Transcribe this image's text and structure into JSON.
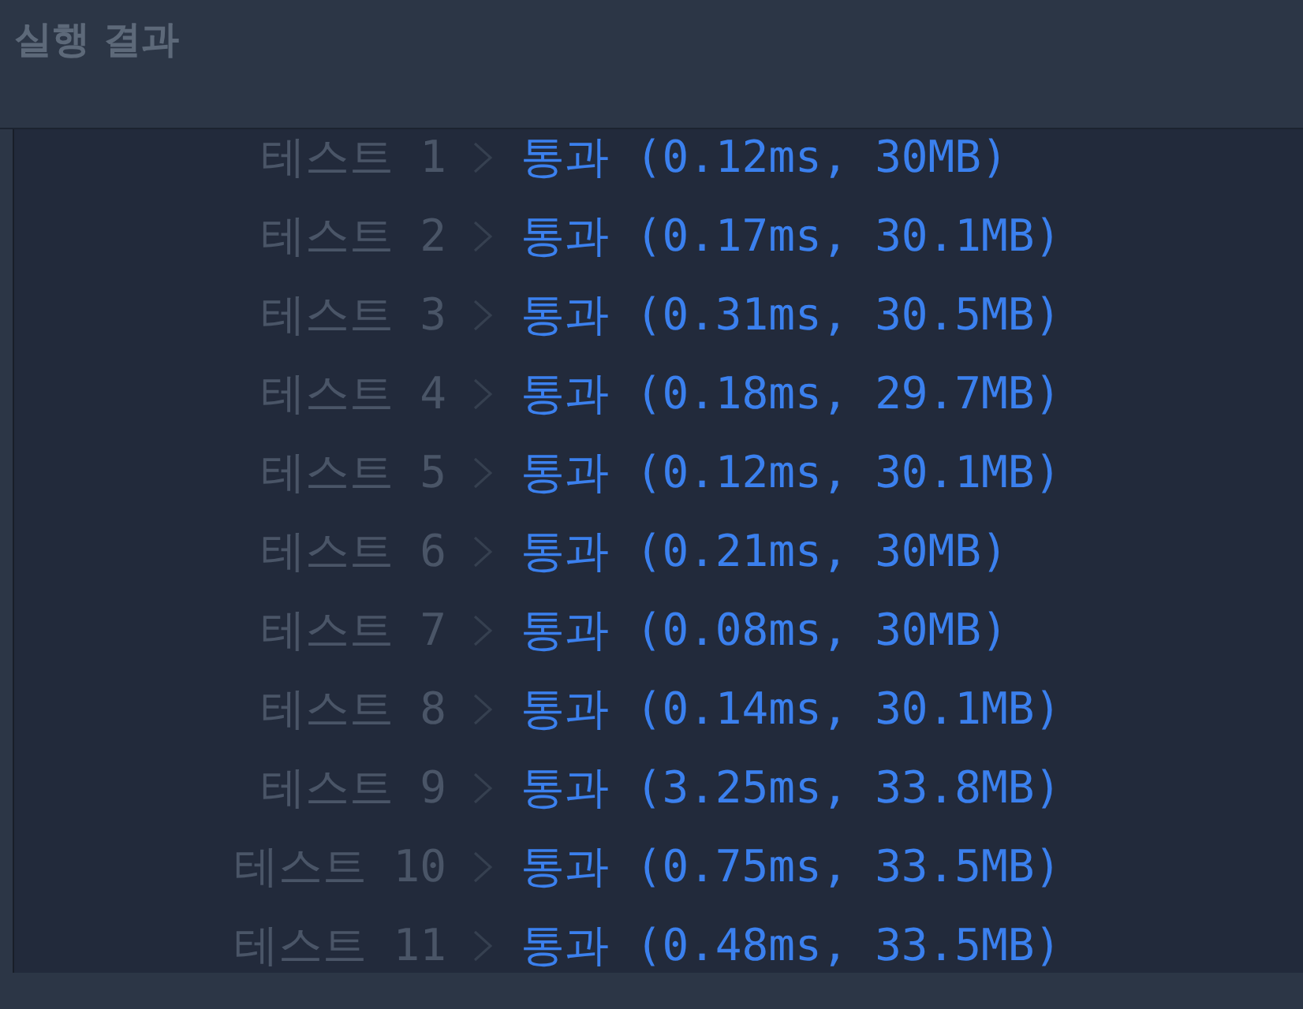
{
  "panel": {
    "title": "실행 결과"
  },
  "tests": [
    {
      "label": "테스트 1",
      "result": "통과 (0.12ms, 30MB)"
    },
    {
      "label": "테스트 2",
      "result": "통과 (0.17ms, 30.1MB)"
    },
    {
      "label": "테스트 3",
      "result": "통과 (0.31ms, 30.5MB)"
    },
    {
      "label": "테스트 4",
      "result": "통과 (0.18ms, 29.7MB)"
    },
    {
      "label": "테스트 5",
      "result": "통과 (0.12ms, 30.1MB)"
    },
    {
      "label": "테스트 6",
      "result": "통과 (0.21ms, 30MB)"
    },
    {
      "label": "테스트 7",
      "result": "통과 (0.08ms, 30MB)"
    },
    {
      "label": "테스트 8",
      "result": "통과 (0.14ms, 30.1MB)"
    },
    {
      "label": "테스트 9",
      "result": "통과 (3.25ms, 33.8MB)"
    },
    {
      "label": "테스트 10",
      "result": "통과 (0.75ms, 33.5MB)"
    },
    {
      "label": "테스트 11",
      "result": "통과 (0.48ms, 33.5MB)"
    }
  ]
}
